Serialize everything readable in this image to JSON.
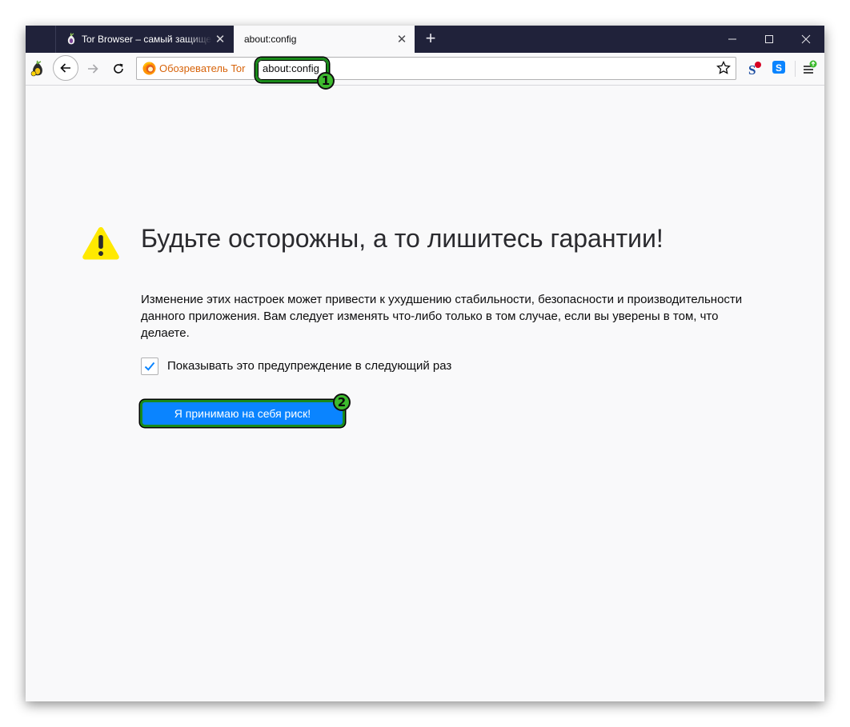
{
  "tabs": [
    {
      "title": "Tor Browser – самый защищенный",
      "close_glyph": "✕",
      "icon": "tor-onion-icon"
    },
    {
      "title": "about:config",
      "close_glyph": "✕"
    }
  ],
  "new_tab_glyph": "+",
  "window_controls": {
    "minimize": "minimize-icon",
    "maximize": "maximize-icon",
    "close": "close-icon"
  },
  "navbar": {
    "identity_label": "Обозреватель Tor",
    "url": "about:config"
  },
  "annotations": {
    "badge1": "1",
    "badge2": "2",
    "color": "#3dbb2e"
  },
  "content": {
    "heading": "Будьте осторожны, а то лишитесь гарантии!",
    "description": "Изменение этих настроек может привести к ухудшению стабильности, безопасности и производительности данного приложения. Вам следует изменять что-либо только в том случае, если вы уверены в том, что делаете.",
    "checkbox_label": "Показывать это предупреждение в следующий раз",
    "checkbox_checked": true,
    "accept_button": "Я принимаю на себя риск!"
  },
  "colors": {
    "accent": "#0a84ff",
    "warning": "#ffe900",
    "tabstrip": "#20223a",
    "identity": "#d7640b"
  }
}
